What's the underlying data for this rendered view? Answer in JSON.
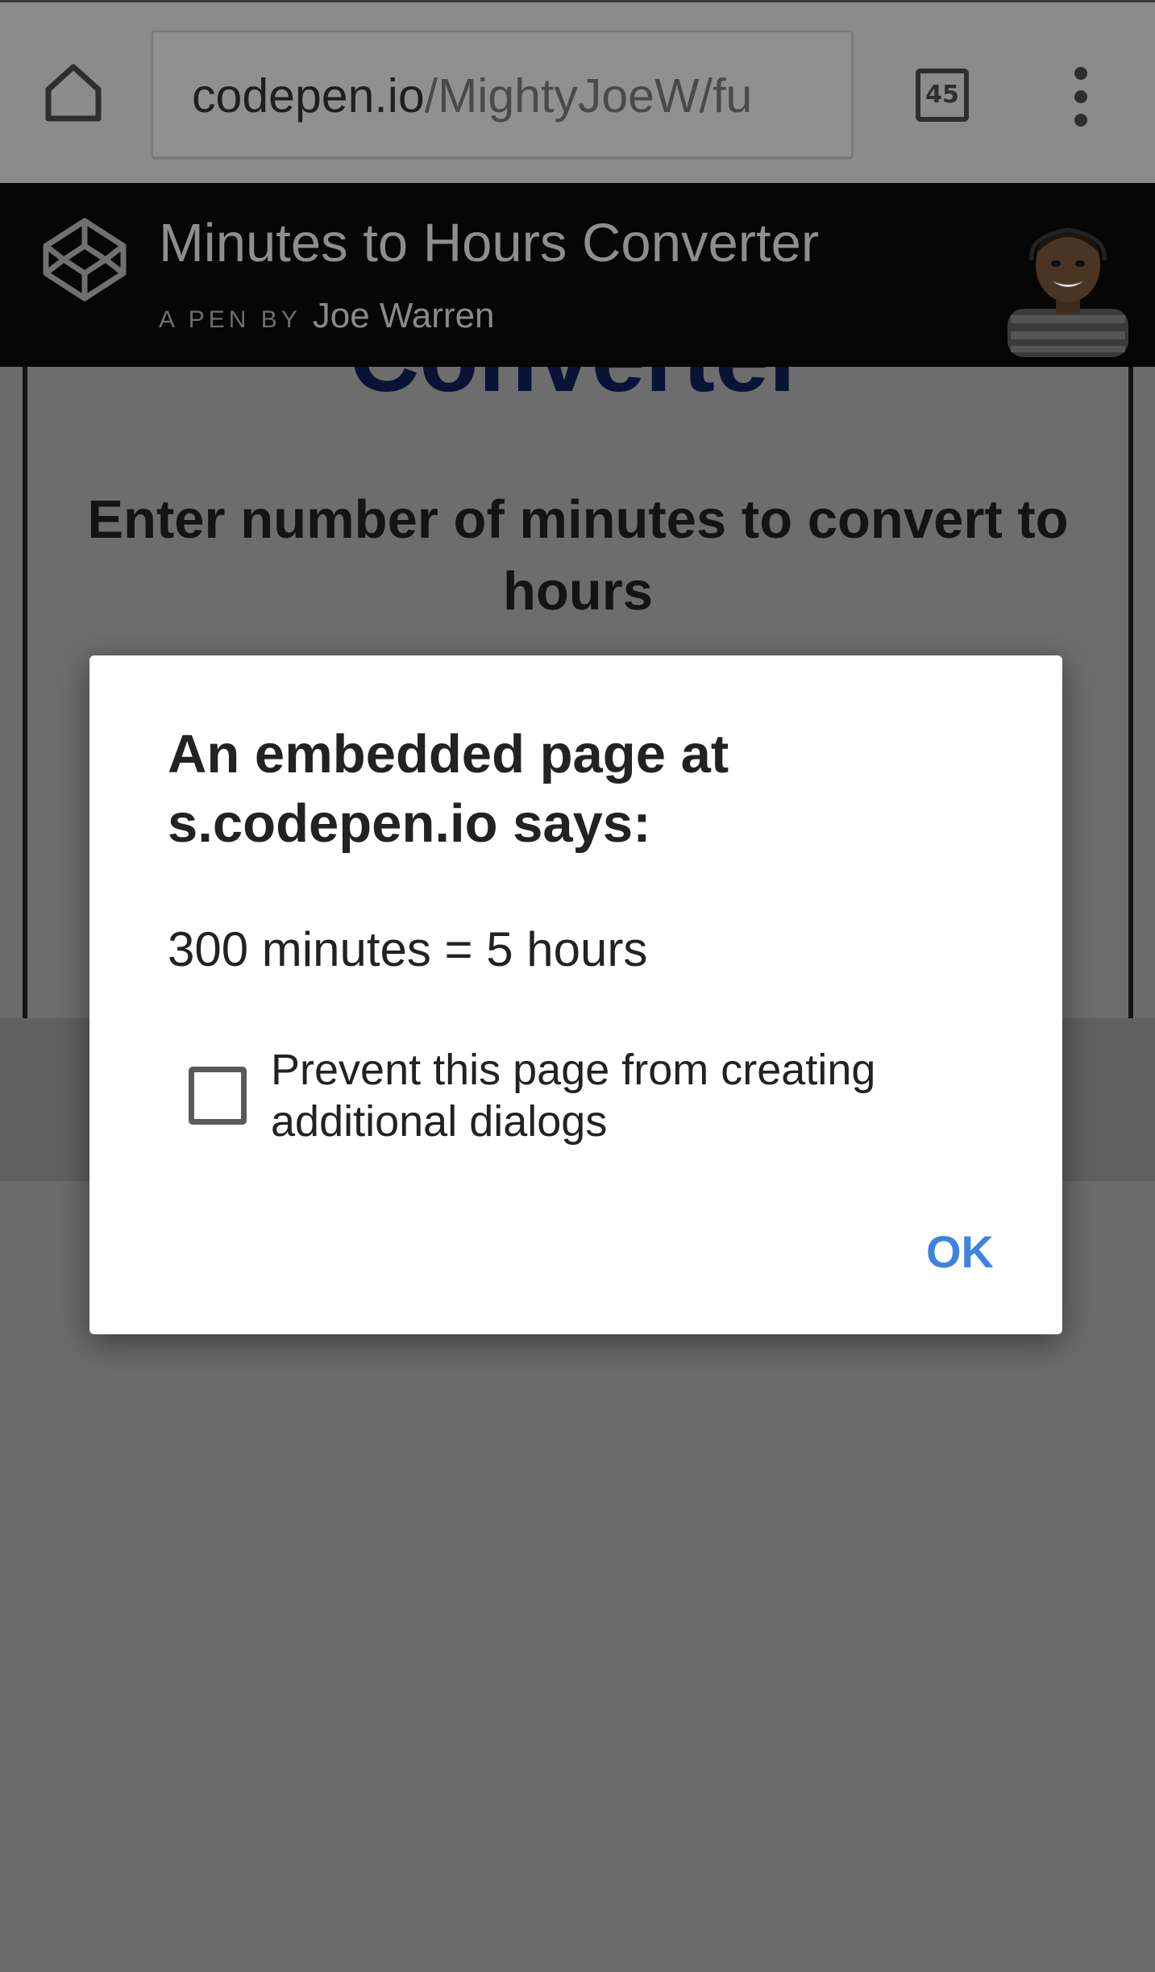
{
  "browser": {
    "url_host": "codepen.io",
    "url_path": "/MightyJoeW/fu",
    "tab_count": "45",
    "icons": {
      "home": "home-icon",
      "tabs": "tab-switcher-icon",
      "menu": "more-vert-icon"
    }
  },
  "codepen": {
    "title": "Minutes to Hours Converter",
    "by_prefix": "A PEN BY",
    "author": "Joe Warren",
    "logo_icon": "codepen-logo-icon"
  },
  "page": {
    "heading_partial": "Converter",
    "prompt": "Enter number of minutes to convert to hours"
  },
  "dialog": {
    "title": "An embedded page at s.codepen.io says:",
    "message": "300 minutes = 5 hours",
    "checkbox_label": "Prevent this page from creating additional dialogs",
    "checkbox_checked": false,
    "ok_label": "OK",
    "accent_color": "#3f83e0"
  }
}
